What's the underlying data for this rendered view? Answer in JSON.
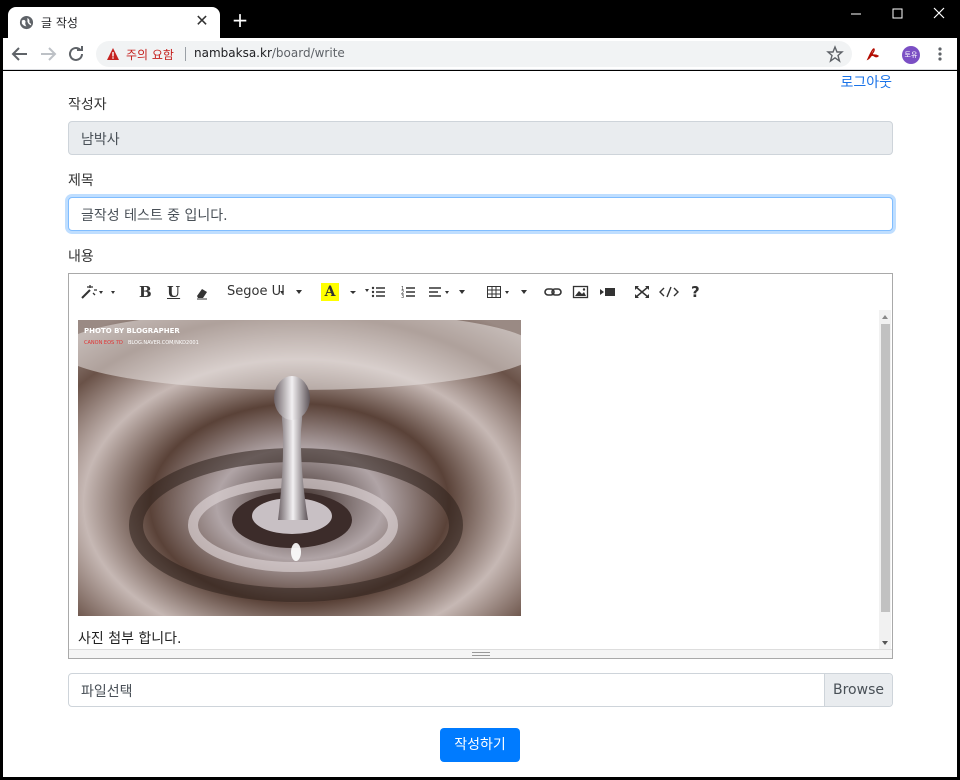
{
  "browser": {
    "tab_title": "글 작성",
    "new_tab": "+",
    "security_label": "주의 요함",
    "url_host": "nambaksa.kr",
    "url_path": "/board/write",
    "profile_initials": "토유"
  },
  "header": {
    "logout_link": "로그아웃"
  },
  "form": {
    "author_label": "작성자",
    "author_value": "남박사",
    "title_label": "제목",
    "title_value": "글작성 테스트 중 입니다.",
    "content_label": "내용",
    "toolbar": {
      "font_name": "Segoe UI",
      "bold": "B",
      "underline": "U",
      "highlight": "A",
      "help": "?"
    },
    "photo_watermark_line1": "PHOTO BY BLOGRAPHER",
    "photo_watermark_line2a": "CANON EOS 7D",
    "photo_watermark_line2b": "BLOG.NAVER.COM/NKD2001",
    "content_text": "사진 첨부 합니다.",
    "file_placeholder": "파일선택",
    "browse_button": "Browse",
    "submit_button": "작성하기"
  },
  "colors": {
    "primary": "#007bff",
    "link": "#1a73e8",
    "warning": "#c5221f"
  }
}
